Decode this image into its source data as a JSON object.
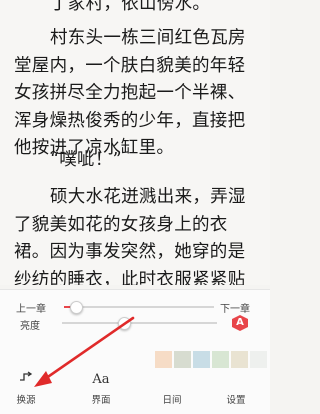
{
  "reader": {
    "paragraphs": [
      "丁家村，依山傍水。",
      "村东头一栋三间红色瓦房堂屋内，一个肤白貌美的年轻女孩拼尽全力抱起一个半裸、浑身燥热俊秀的少年，直接把他按进了凉水缸里。",
      "“噗呲！”",
      "硕大水花迸溅出来，弄湿了貌美如花的女孩身上的衣裙。因为事发突然，她穿的是纱纺的睡衣，此时衣服紧紧贴在身上，尽显婀娜妖娆身材。"
    ]
  },
  "controls": {
    "prev_chapter": "上一章",
    "next_chapter": "下一章",
    "chapter_progress": 0.08,
    "brightness_label": "亮度",
    "brightness_level": 0.4,
    "auto_brightness_glyph": "A",
    "theme_swatches": [
      "#f6dcc6",
      "#d7dcd0",
      "#c8dde6",
      "#d8e6d3",
      "#e9e3d2",
      "#eef0ee"
    ],
    "tools": [
      {
        "label": "换源",
        "icon": "source-switch-icon"
      },
      {
        "label": "界面",
        "icon": "font-style-icon"
      },
      {
        "label": "日间",
        "icon": "day-mode-icon"
      },
      {
        "label": "设置",
        "icon": "settings-icon"
      }
    ],
    "accent_color": "#e8454a"
  }
}
